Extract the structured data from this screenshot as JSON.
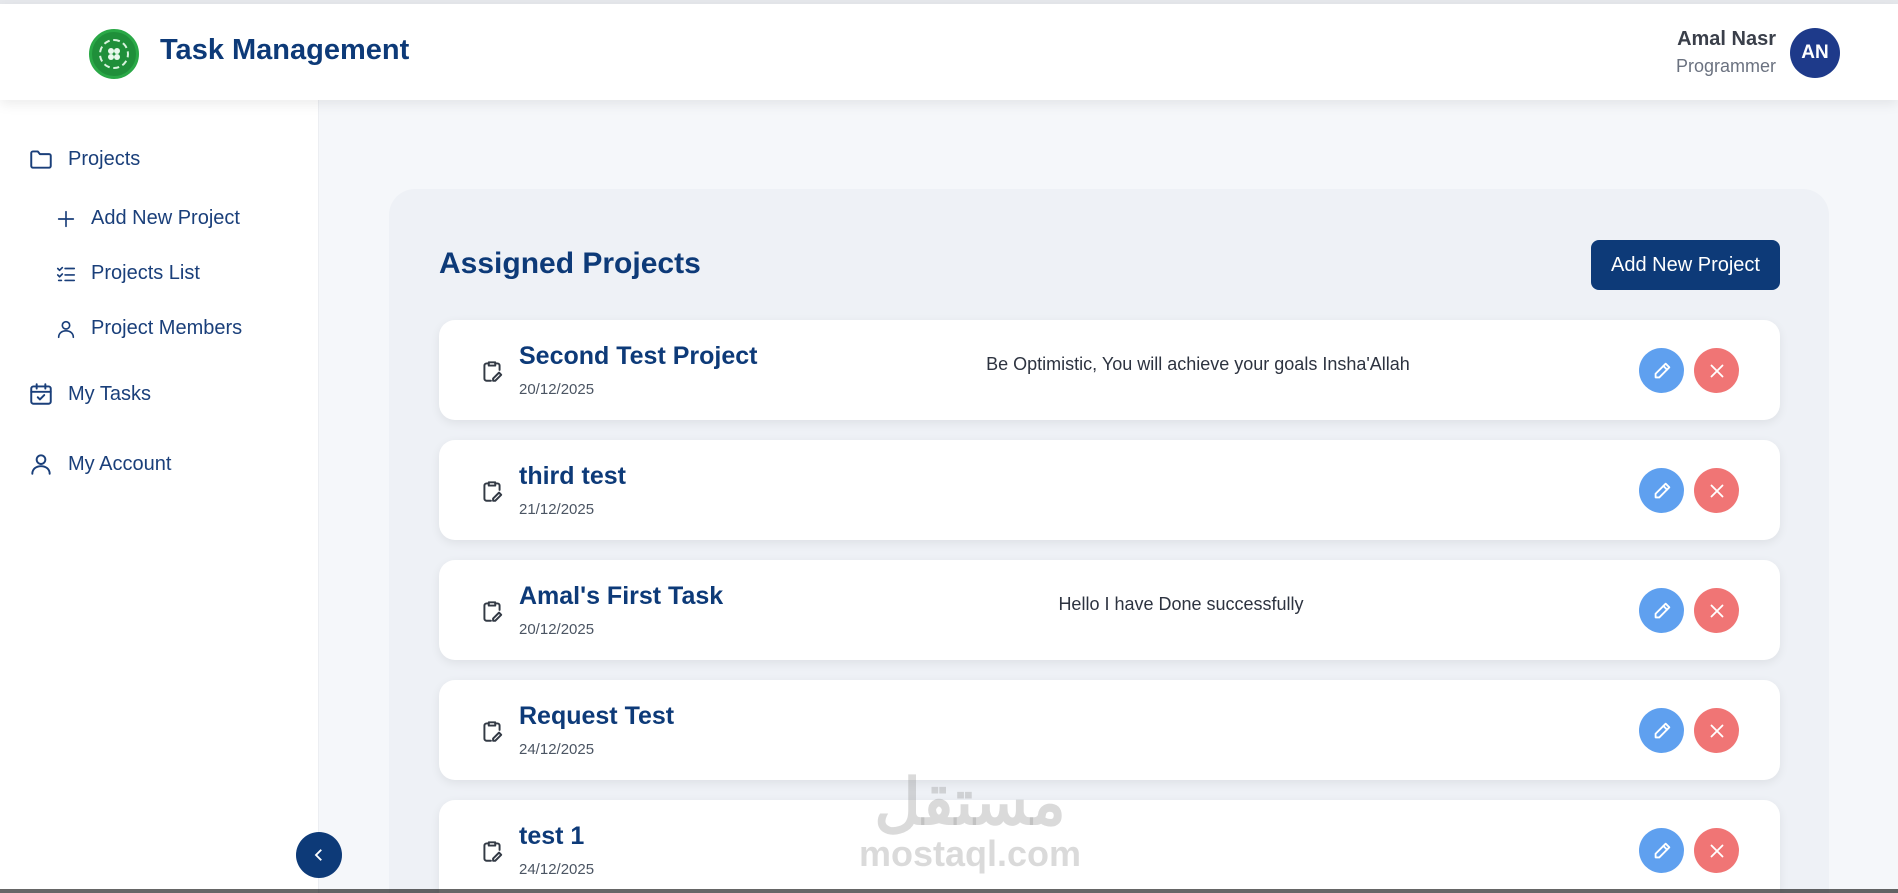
{
  "header": {
    "title": "Task Management",
    "user_name": "Amal Nasr",
    "user_role": "Programmer",
    "avatar_initials": "AN"
  },
  "sidebar": {
    "items": [
      {
        "label": "Projects",
        "icon": "folder-icon"
      },
      {
        "label": "Add New Project",
        "icon": "plus-icon"
      },
      {
        "label": "Projects List",
        "icon": "checklist-icon"
      },
      {
        "label": "Project Members",
        "icon": "user-icon"
      },
      {
        "label": "My Tasks",
        "icon": "calendar-check-icon"
      },
      {
        "label": "My Account",
        "icon": "user-icon"
      }
    ]
  },
  "main": {
    "title": "Assigned Projects",
    "add_button_label": "Add New Project",
    "projects": [
      {
        "name": "Second Test Project",
        "date": "20/12/2025",
        "description": "Be Optimistic, You will achieve your goals Insha'Allah"
      },
      {
        "name": "third test",
        "date": "21/12/2025",
        "description": ""
      },
      {
        "name": "Amal's First Task",
        "date": "20/12/2025",
        "description": "Hello I have Done successfully"
      },
      {
        "name": "Request Test",
        "date": "24/12/2025",
        "description": ""
      },
      {
        "name": "test 1",
        "date": "24/12/2025",
        "description": ""
      }
    ]
  },
  "watermark": {
    "arabic": "مستقل",
    "latin": "mostaql.com"
  },
  "colors": {
    "brand": "#0d3a78",
    "edit": "#5fa0ef",
    "delete": "#f07575"
  }
}
